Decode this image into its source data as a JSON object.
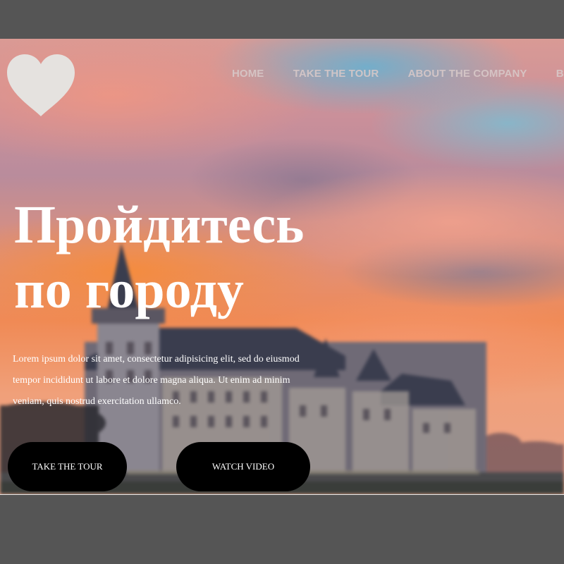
{
  "header": {
    "logo": {
      "icon": "heart-icon",
      "color": "#e5e2df"
    },
    "nav": [
      {
        "label": "HOME"
      },
      {
        "label": "TAKE THE TOUR"
      },
      {
        "label": "ABOUT THE COMPANY"
      },
      {
        "label": "BL"
      }
    ]
  },
  "hero": {
    "title_line1": "Пройдитесь",
    "title_line2": "по городу",
    "text": "Lorem ipsum dolor sit amet, consectetur adipisicing elit, sed do eiusmod tempor incididunt ut labore et dolore magna aliqua. Ut enim ad minim veniam, quis nostrud exercitation ullamco.",
    "buttons": {
      "tour_label": "TAKE THE TOUR",
      "video_label": "WATCH VIDEO"
    }
  },
  "colors": {
    "page_background": "#555555",
    "button_background": "#000000",
    "title_color": "#ffffff"
  }
}
